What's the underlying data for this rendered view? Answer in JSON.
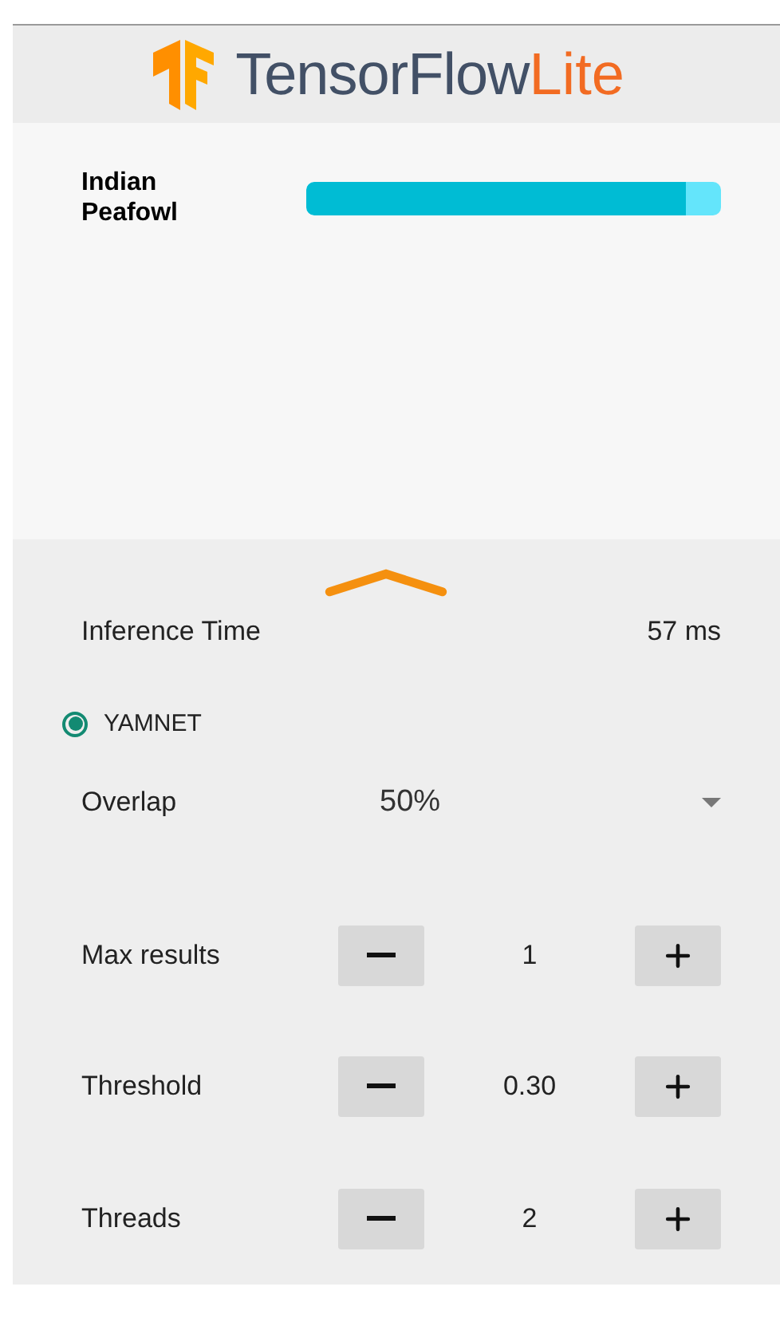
{
  "header": {
    "brand": "TensorFlow",
    "suffix": "Lite"
  },
  "results": [
    {
      "label": "Indian\nPeafowl",
      "level": 0.915
    }
  ],
  "inference": {
    "label": "Inference Time",
    "value": "57 ms"
  },
  "models": [
    {
      "label": "YAMNET",
      "selected": true
    }
  ],
  "overlap": {
    "label": "Overlap",
    "value": "50%"
  },
  "steppers": [
    {
      "label": "Max results",
      "value": "1"
    },
    {
      "label": "Threshold",
      "value": "0.30"
    },
    {
      "label": "Threads",
      "value": "2"
    }
  ]
}
